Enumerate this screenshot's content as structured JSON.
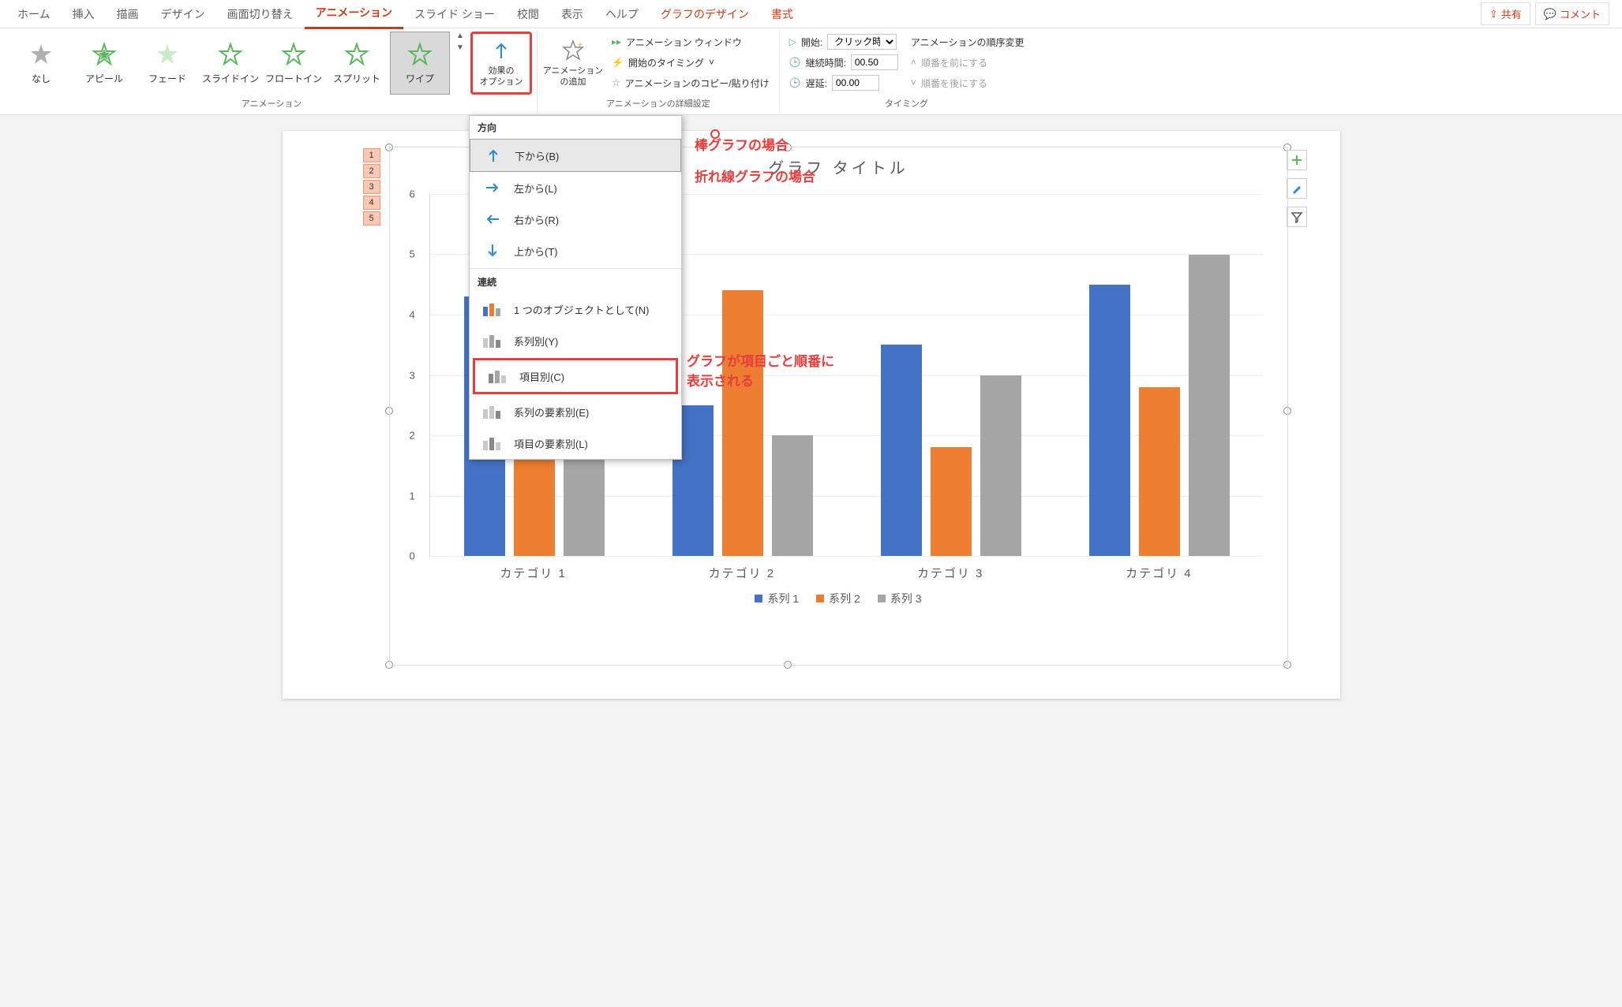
{
  "tabs": {
    "home": "ホーム",
    "insert": "挿入",
    "draw": "描画",
    "design": "デザイン",
    "transition": "画面切り替え",
    "animation": "アニメーション",
    "slideshow": "スライド ショー",
    "review": "校閲",
    "view": "表示",
    "help": "ヘルプ",
    "chartdesign": "グラフのデザイン",
    "format": "書式"
  },
  "topbtn": {
    "share": "共有",
    "comment": "コメント"
  },
  "ribbon": {
    "anims": {
      "none": "なし",
      "appear": "アピール",
      "fade": "フェード",
      "slidein": "スライドイン",
      "floatin": "フロートイン",
      "split": "スプリット",
      "wipe": "ワイプ"
    },
    "effect_options": "効果の\nオプション",
    "add_anim": "アニメーション\nの追加",
    "pane": "アニメーション ウィンドウ",
    "trigger": "開始のタイミング",
    "painter": "アニメーションのコピー/貼り付け",
    "start_lbl": "開始:",
    "start_val": "クリック時",
    "duration_lbl": "継続時間:",
    "duration_val": "00.50",
    "delay_lbl": "遅延:",
    "delay_val": "00.00",
    "reorder": "アニメーションの順序変更",
    "move_before": "順番を前にする",
    "move_after": "順番を後にする",
    "group_anim": "アニメーション",
    "group_adv": "アニメーションの詳細設定",
    "group_timing": "タイミング"
  },
  "dd": {
    "dir_header": "方向",
    "from_bottom": "下から(B)",
    "from_left": "左から(L)",
    "from_right": "右から(R)",
    "from_top": "上から(T)",
    "seq_header": "連続",
    "as_one": "1 つのオブジェクトとして(N)",
    "by_series": "系列別(Y)",
    "by_category": "項目別(C)",
    "by_series_elem": "系列の要素別(E)",
    "by_category_elem": "項目の要素別(L)"
  },
  "anno": {
    "bar": "棒グラフの場合",
    "line": "折れ線グラフの場合",
    "cat": "グラフが項目ごと順番に\n表示される"
  },
  "seq": [
    "1",
    "2",
    "3",
    "4",
    "5"
  ],
  "chart_data": {
    "type": "bar",
    "title": "グラフ タイトル",
    "categories": [
      "カテゴリ 1",
      "カテゴリ 2",
      "カテゴリ 3",
      "カテゴリ 4"
    ],
    "series": [
      {
        "name": "系列 1",
        "values": [
          4.3,
          2.5,
          3.5,
          4.5
        ]
      },
      {
        "name": "系列 2",
        "values": [
          2.4,
          4.4,
          1.8,
          2.8
        ]
      },
      {
        "name": "系列 3",
        "values": [
          2.0,
          2.0,
          3.0,
          5.0
        ]
      }
    ],
    "ylim": [
      0,
      6
    ],
    "yticks": [
      0,
      1,
      2,
      3,
      4,
      5,
      6
    ],
    "colors": {
      "s1": "#4472c4",
      "s2": "#ed7d31",
      "s3": "#a5a5a5"
    }
  }
}
